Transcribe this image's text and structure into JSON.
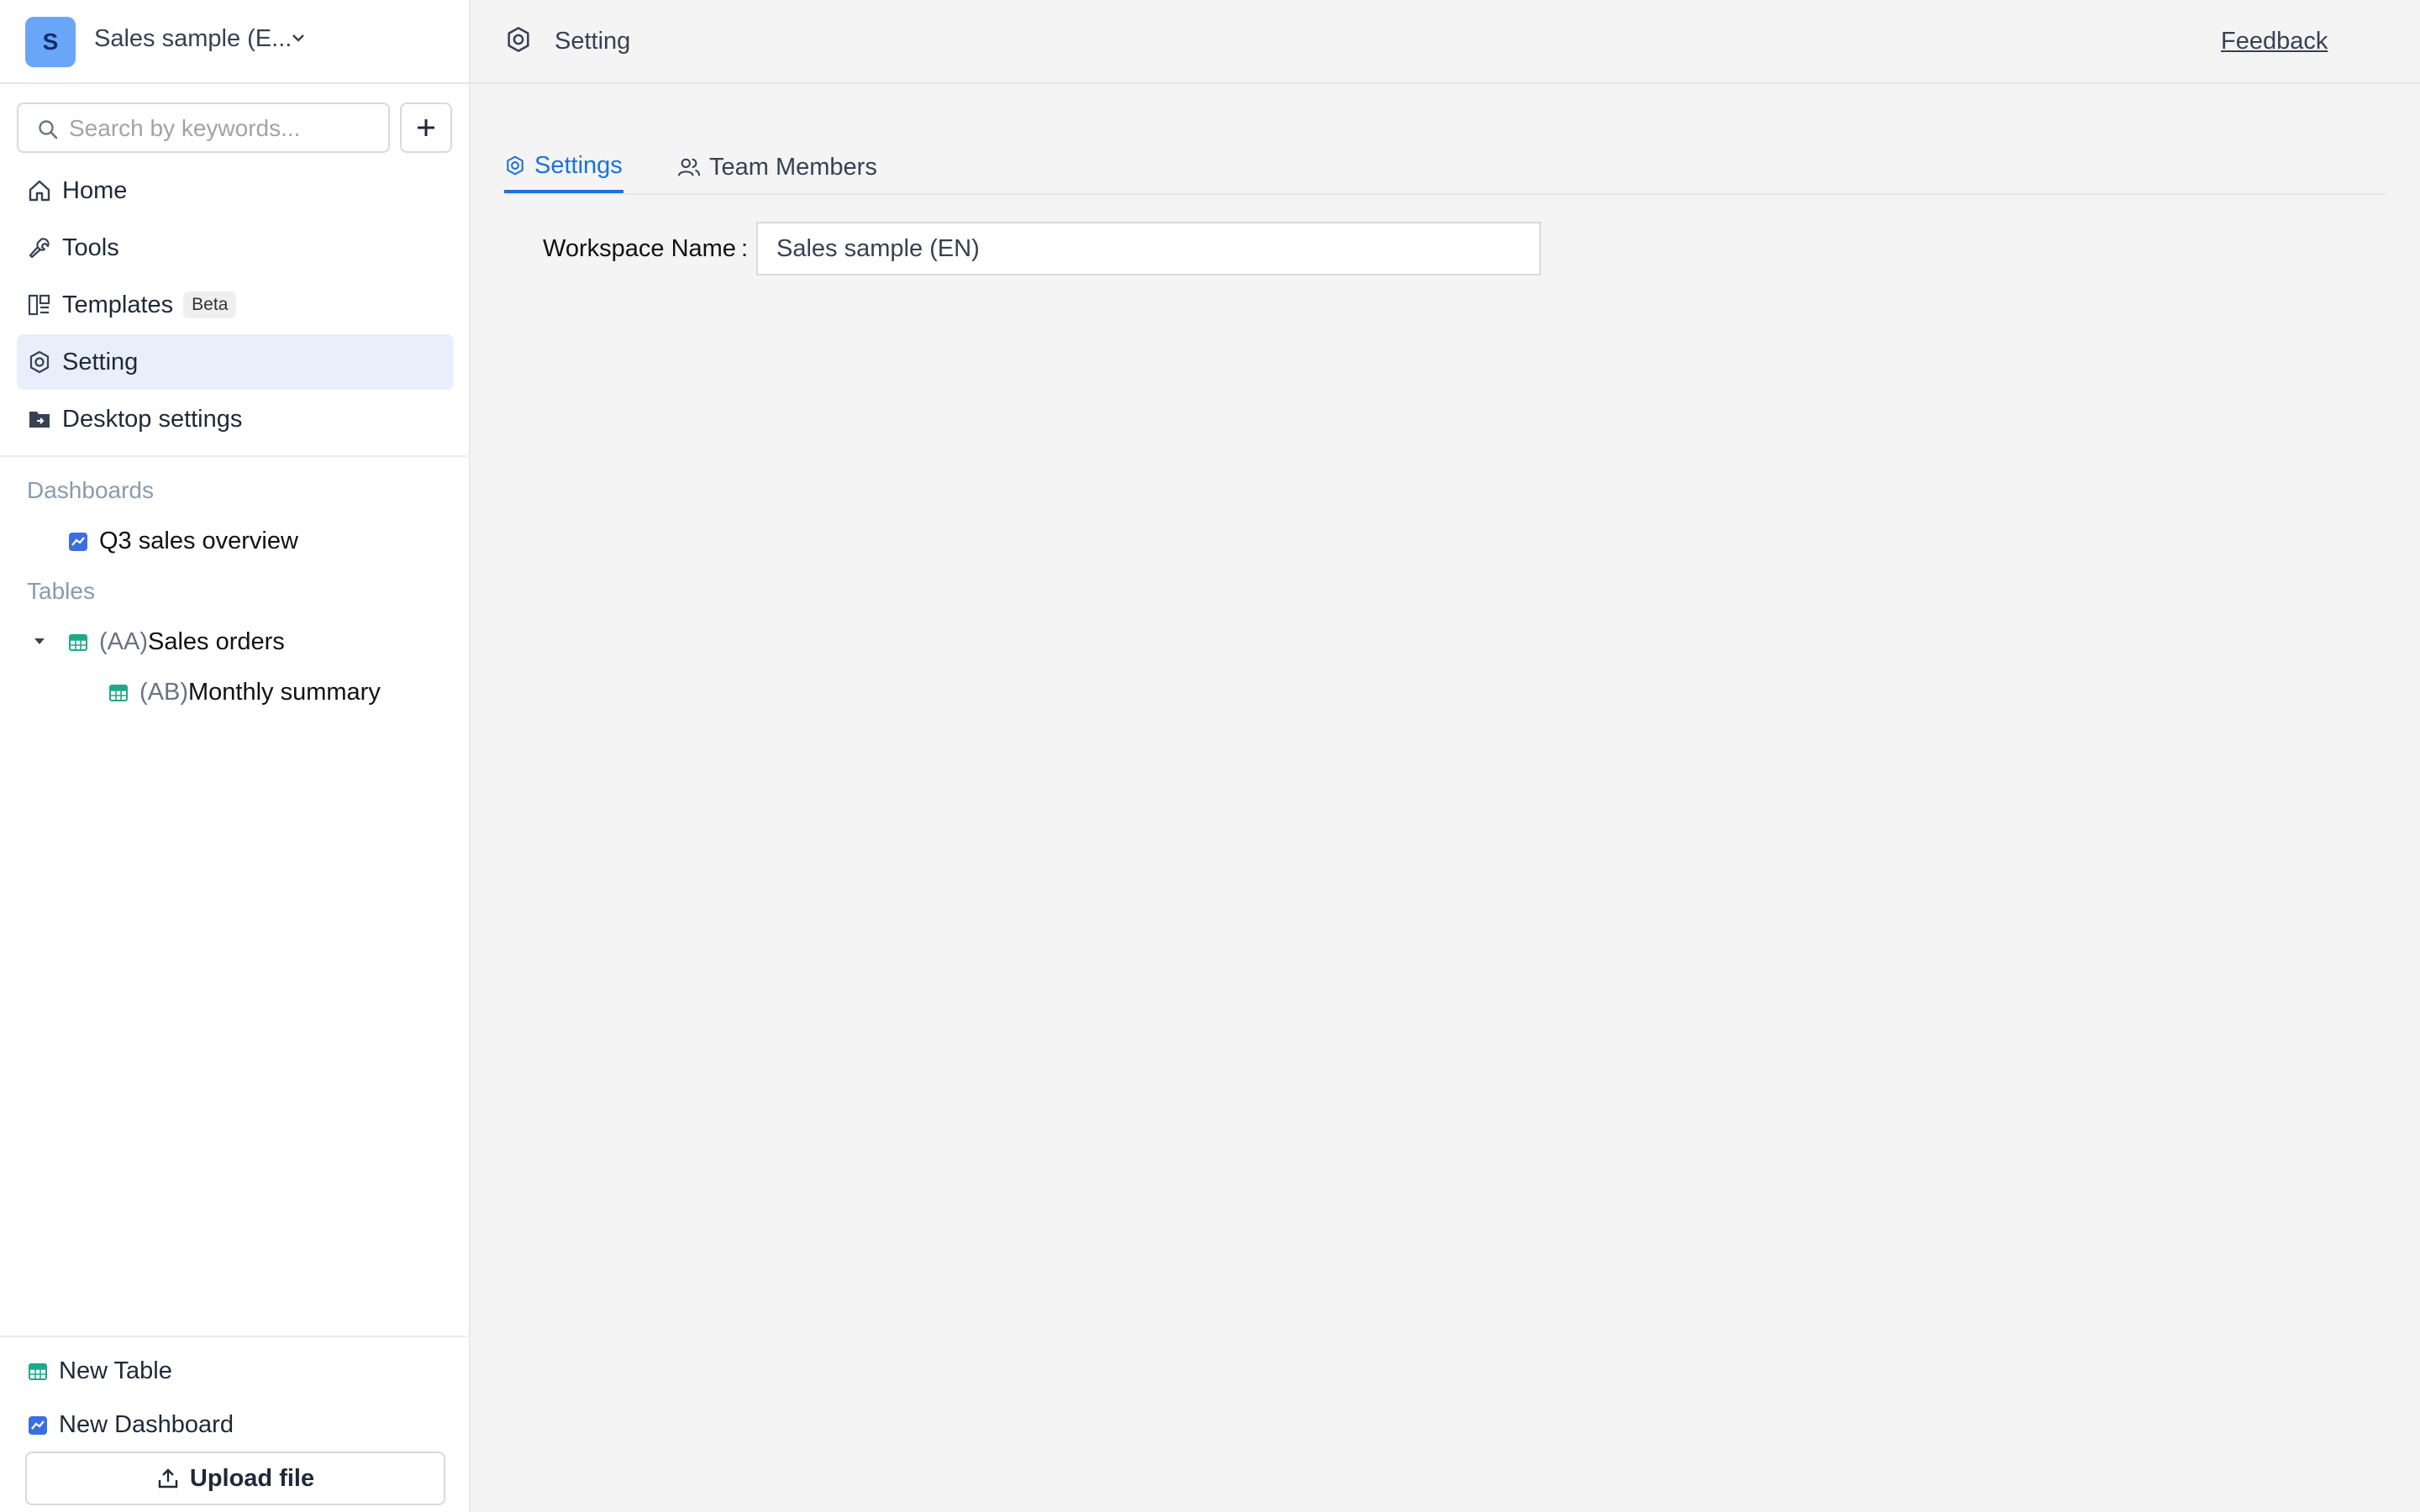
{
  "workspace": {
    "avatar_letter": "S",
    "name": "Sales sample (E..."
  },
  "search": {
    "placeholder": "Search by keywords..."
  },
  "nav": [
    {
      "label": "Home",
      "icon": "home-icon"
    },
    {
      "label": "Tools",
      "icon": "wrench-icon"
    },
    {
      "label": "Templates",
      "icon": "templates-icon",
      "badge": "Beta"
    },
    {
      "label": "Setting",
      "icon": "gear-icon",
      "active": true
    },
    {
      "label": "Desktop settings",
      "icon": "desktop-folder-icon"
    }
  ],
  "sections": {
    "dashboards_title": "Dashboards",
    "dashboards": [
      {
        "label": "Q3 sales overview",
        "icon": "chart-icon"
      }
    ],
    "tables_title": "Tables",
    "tables": [
      {
        "prefix": "(AA)",
        "label": "Sales orders",
        "icon": "table-icon",
        "expanded": true
      },
      {
        "prefix": "(AB)",
        "label": "Monthly summary",
        "icon": "table-icon"
      }
    ]
  },
  "bottom": {
    "new_table": "New Table",
    "new_dashboard": "New Dashboard",
    "upload": "Upload file"
  },
  "topbar": {
    "title": "Setting",
    "feedback": "Feedback"
  },
  "tabs": [
    {
      "label": "Settings",
      "icon": "gear-icon",
      "active": true
    },
    {
      "label": "Team Members",
      "icon": "users-icon"
    }
  ],
  "form": {
    "workspace_label": "Workspace Name",
    "colon": ":",
    "workspace_value": "Sales sample (EN)"
  },
  "colors": {
    "accent": "#1a73d9",
    "active_bg": "#e8effa",
    "avatar": "#6aa6f7",
    "table_icon": "#1fa98a",
    "chart_icon": "#3b6fe0"
  }
}
